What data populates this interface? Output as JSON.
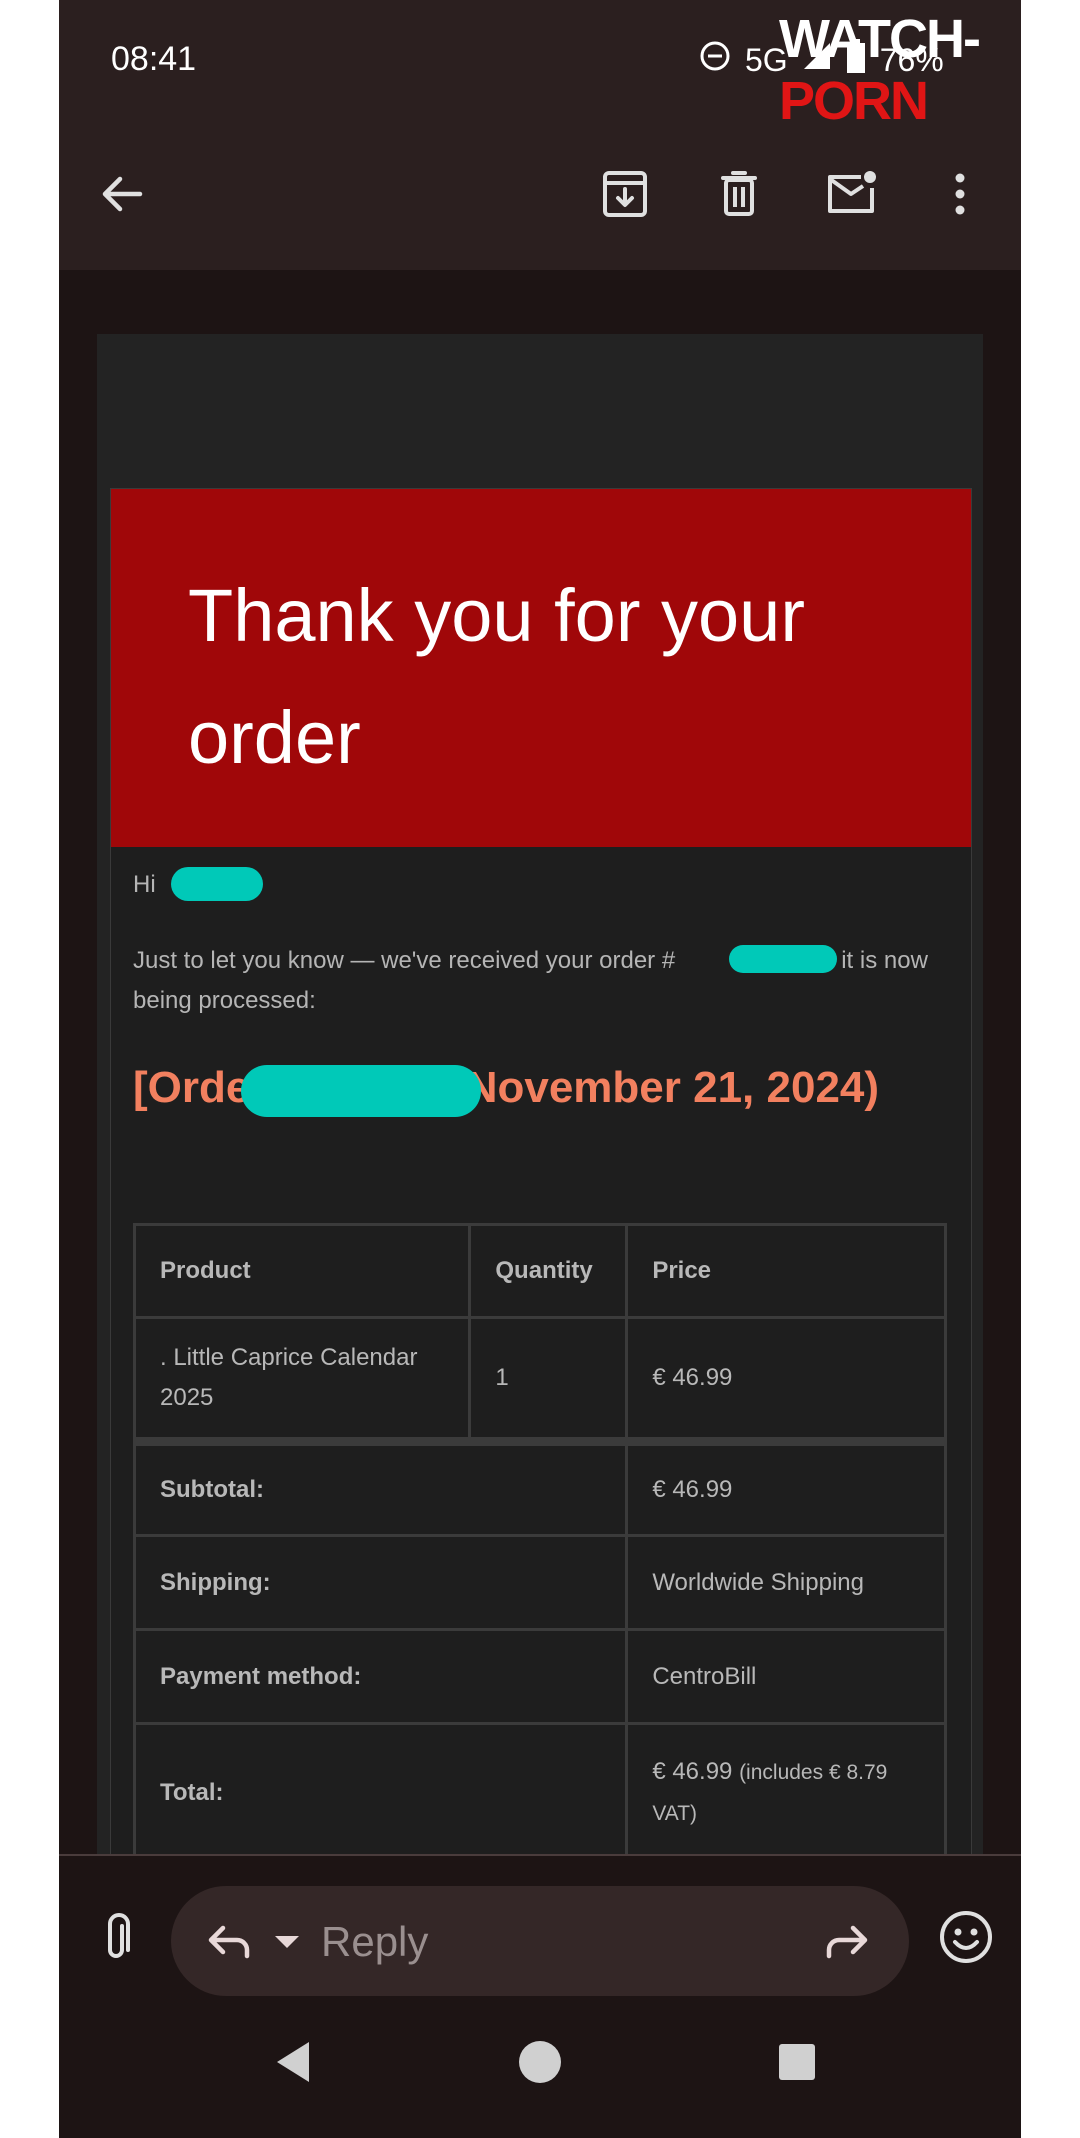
{
  "status_bar": {
    "time": "08:41",
    "network": "5G",
    "battery": "76%",
    "icons": [
      "do-not-disturb-icon",
      "signal-icon",
      "battery-icon"
    ]
  },
  "watermark": {
    "part1": "WATCH-",
    "part2": "PORN"
  },
  "toolbar": {
    "icons": [
      "back-arrow-icon",
      "archive-icon",
      "delete-icon",
      "mark-unread-icon",
      "more-vert-icon"
    ]
  },
  "email": {
    "hero_title": "Thank you for your order",
    "greeting": "Hi",
    "intro_part1": "Just to let you know — we've received your order #",
    "intro_part2": ", and it is now being processed:",
    "order_heading_part1": "[Order #",
    "order_heading_part2": "] (November 21, 2024)",
    "table": {
      "headers": [
        "Product",
        "Quantity",
        "Price"
      ],
      "rows": [
        {
          "product": ". Little Caprice Calendar 2025",
          "quantity": "1",
          "price": "€ 46.99"
        }
      ],
      "totals": [
        {
          "label": "Subtotal:",
          "value": "€ 46.99"
        },
        {
          "label": "Shipping:",
          "value": "Worldwide Shipping"
        },
        {
          "label": "Payment method:",
          "value": "CentroBill"
        },
        {
          "label": "Total:",
          "value": "€ 46.99",
          "note": "(includes € 8.79 VAT)"
        }
      ]
    }
  },
  "reply_bar": {
    "reply_label": "Reply"
  },
  "colors": {
    "hero_red": "#a00709",
    "heading_orange": "#f2805f",
    "redaction_teal": "#00c9b8",
    "background": "#1d1414"
  }
}
